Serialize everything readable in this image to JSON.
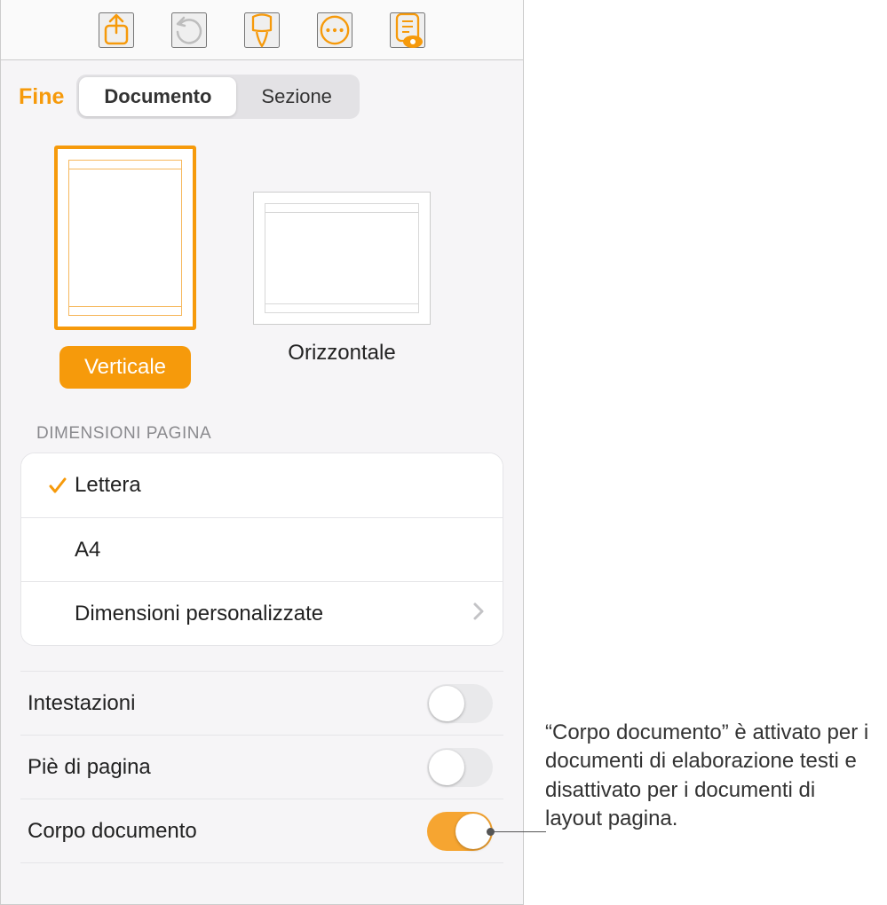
{
  "header": {
    "done_label": "Fine",
    "tabs": {
      "document": "Documento",
      "section": "Sezione"
    }
  },
  "orientation": {
    "vertical_label": "Verticale",
    "horizontal_label": "Orizzontale"
  },
  "page_size": {
    "section_title": "Dimensioni pagina",
    "letter": "Lettera",
    "a4": "A4",
    "custom": "Dimensioni personalizzate"
  },
  "toggles": {
    "headers": "Intestazioni",
    "footers": "Piè di pagina",
    "document_body": "Corpo documento"
  },
  "callout": "“Corpo documento” è attivato per i documenti di elaborazione testi e disattivato per i documenti di layout pagina."
}
